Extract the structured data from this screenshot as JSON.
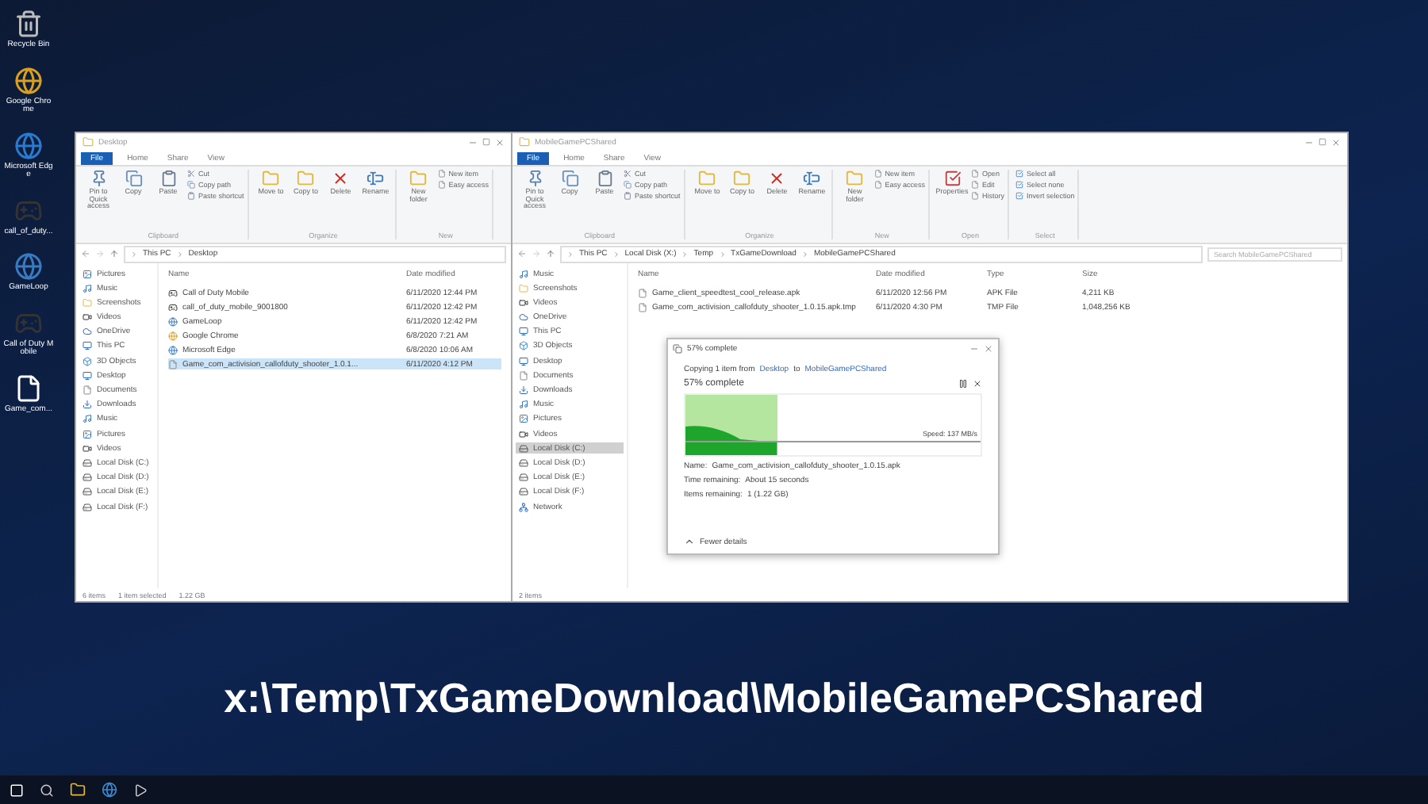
{
  "desktop_icons": [
    {
      "label": "Recycle Bin",
      "kind": "bin"
    },
    {
      "label": "Google Chrome",
      "kind": "browser"
    },
    {
      "label": "Microsoft Edge",
      "kind": "edge"
    },
    {
      "label": "call_of_duty...",
      "kind": "game"
    },
    {
      "label": "GameLoop",
      "kind": "loop"
    },
    {
      "label": "Call of Duty Mobile",
      "kind": "game"
    },
    {
      "label": "Game_com...",
      "kind": "file"
    }
  ],
  "windows": [
    {
      "title": "Desktop",
      "file_tab": "File",
      "tabs": [
        {
          "label": "Home",
          "selected": false
        },
        {
          "label": "Share",
          "selected": false
        },
        {
          "label": "View",
          "selected": false
        }
      ],
      "ribbon": [
        {
          "label": "Clipboard",
          "buttons": [
            {
              "label": "Pin to Quick access",
              "kind": "pin"
            },
            {
              "label": "Copy",
              "kind": "copy"
            },
            {
              "label": "Paste",
              "kind": "paste"
            }
          ],
          "small": [
            {
              "label": "Cut",
              "kind": "cut"
            },
            {
              "label": "Copy path",
              "kind": "copy"
            },
            {
              "label": "Paste shortcut",
              "kind": "paste"
            }
          ]
        },
        {
          "label": "Organize",
          "buttons": [
            {
              "label": "Move to",
              "kind": "folder"
            },
            {
              "label": "Copy to",
              "kind": "folder"
            },
            {
              "label": "Delete",
              "kind": "delete"
            },
            {
              "label": "Rename",
              "kind": "rename"
            }
          ]
        },
        {
          "label": "New",
          "buttons": [
            {
              "label": "New folder",
              "kind": "folder"
            }
          ],
          "small": [
            {
              "label": "New item",
              "kind": "file"
            },
            {
              "label": "Easy access",
              "kind": "file"
            }
          ]
        }
      ],
      "path": [
        "This PC",
        "Desktop"
      ],
      "nav": [
        {
          "label": "Pictures",
          "kind": "image",
          "selected": false
        },
        {
          "label": "Music",
          "kind": "music",
          "selected": false
        },
        {
          "label": "Screenshots",
          "kind": "folder",
          "selected": false
        },
        {
          "label": "Videos",
          "kind": "video",
          "selected": false
        },
        {
          "label": "OneDrive",
          "kind": "cloud",
          "selected": false
        },
        {
          "label": "This PC",
          "kind": "pc",
          "selected": false
        },
        {
          "label": "3D Objects",
          "kind": "box",
          "selected": false
        },
        {
          "label": "Desktop",
          "kind": "pc",
          "selected": false
        },
        {
          "label": "Documents",
          "kind": "file",
          "selected": false
        },
        {
          "label": "Downloads",
          "kind": "download",
          "selected": false
        },
        {
          "label": "Music",
          "kind": "music",
          "selected": false
        },
        {
          "label": "Pictures",
          "kind": "image",
          "selected": false
        },
        {
          "label": "Videos",
          "kind": "video",
          "selected": false
        },
        {
          "label": "Local Disk (C:)",
          "kind": "disk",
          "selected": false
        },
        {
          "label": "Local Disk (D:)",
          "kind": "disk",
          "selected": false
        },
        {
          "label": "Local Disk (E:)",
          "kind": "disk",
          "selected": false
        },
        {
          "label": "Local Disk (F:)",
          "kind": "disk",
          "selected": false
        }
      ],
      "columns": [
        "Name",
        "Date modified"
      ],
      "rows": [
        {
          "cells": [
            "Call of Duty Mobile",
            "6/11/2020 12:44 PM"
          ],
          "kind": "game",
          "selected": false
        },
        {
          "cells": [
            "call_of_duty_mobile_9001800",
            "6/11/2020 12:42 PM"
          ],
          "kind": "game",
          "selected": false
        },
        {
          "cells": [
            "GameLoop",
            "6/11/2020 12:42 PM"
          ],
          "kind": "loop",
          "selected": false
        },
        {
          "cells": [
            "Google Chrome",
            "6/8/2020 7:21 AM"
          ],
          "kind": "browser",
          "selected": false
        },
        {
          "cells": [
            "Microsoft Edge",
            "6/8/2020 10:06 AM"
          ],
          "kind": "edge",
          "selected": false
        },
        {
          "cells": [
            "Game_com_activision_callofduty_shooter_1.0.1...",
            "6/11/2020 4:12 PM"
          ],
          "kind": "file",
          "selected": true
        }
      ],
      "status": [
        "6 items",
        "1 item selected",
        "1.22 GB"
      ]
    },
    {
      "title": "MobileGamePCShared",
      "file_tab": "File",
      "tabs": [
        {
          "label": "Home",
          "selected": false
        },
        {
          "label": "Share",
          "selected": false
        },
        {
          "label": "View",
          "selected": false
        }
      ],
      "ribbon": [
        {
          "label": "Clipboard",
          "buttons": [
            {
              "label": "Pin to Quick access",
              "kind": "pin"
            },
            {
              "label": "Copy",
              "kind": "copy"
            },
            {
              "label": "Paste",
              "kind": "paste"
            }
          ],
          "small": [
            {
              "label": "Cut",
              "kind": "cut"
            },
            {
              "label": "Copy path",
              "kind": "copy"
            },
            {
              "label": "Paste shortcut",
              "kind": "paste"
            }
          ]
        },
        {
          "label": "Organize",
          "buttons": [
            {
              "label": "Move to",
              "kind": "folder"
            },
            {
              "label": "Copy to",
              "kind": "folder"
            },
            {
              "label": "Delete",
              "kind": "delete"
            },
            {
              "label": "Rename",
              "kind": "rename"
            }
          ]
        },
        {
          "label": "New",
          "buttons": [
            {
              "label": "New folder",
              "kind": "folder"
            }
          ],
          "small": [
            {
              "label": "New item",
              "kind": "file"
            },
            {
              "label": "Easy access",
              "kind": "file"
            }
          ]
        },
        {
          "label": "Open",
          "buttons": [
            {
              "label": "Properties",
              "kind": "props"
            }
          ],
          "small": [
            {
              "label": "Open",
              "kind": "file"
            },
            {
              "label": "Edit",
              "kind": "file"
            },
            {
              "label": "History",
              "kind": "file"
            }
          ]
        },
        {
          "label": "Select",
          "small": [
            {
              "label": "Select all",
              "kind": "select"
            },
            {
              "label": "Select none",
              "kind": "select"
            },
            {
              "label": "Invert selection",
              "kind": "select"
            }
          ]
        }
      ],
      "path": [
        "This PC",
        "Local Disk (X:)",
        "Temp",
        "TxGameDownload",
        "MobileGamePCShared"
      ],
      "search_placeholder": "Search MobileGamePCShared",
      "nav": [
        {
          "label": "Music",
          "kind": "music",
          "selected": false
        },
        {
          "label": "Screenshots",
          "kind": "folder",
          "selected": false
        },
        {
          "label": "Videos",
          "kind": "video",
          "selected": false
        },
        {
          "label": "OneDrive",
          "kind": "cloud",
          "selected": false
        },
        {
          "label": "This PC",
          "kind": "pc",
          "selected": false
        },
        {
          "label": "3D Objects",
          "kind": "box",
          "selected": false
        },
        {
          "label": "Desktop",
          "kind": "pc",
          "selected": false
        },
        {
          "label": "Documents",
          "kind": "file",
          "selected": false
        },
        {
          "label": "Downloads",
          "kind": "download",
          "selected": false
        },
        {
          "label": "Music",
          "kind": "music",
          "selected": false
        },
        {
          "label": "Pictures",
          "kind": "image",
          "selected": false
        },
        {
          "label": "Videos",
          "kind": "video",
          "selected": false
        },
        {
          "label": "Local Disk (C:)",
          "kind": "disk",
          "selected": true
        },
        {
          "label": "Local Disk (D:)",
          "kind": "disk",
          "selected": false
        },
        {
          "label": "Local Disk (E:)",
          "kind": "disk",
          "selected": false
        },
        {
          "label": "Local Disk (F:)",
          "kind": "disk",
          "selected": false
        },
        {
          "label": "Network",
          "kind": "network",
          "selected": false
        }
      ],
      "columns": [
        "Name",
        "Date modified",
        "Type",
        "Size"
      ],
      "rows": [
        {
          "cells": [
            "Game_client_speedtest_cool_release.apk",
            "6/11/2020 12:56 PM",
            "APK File",
            "4,211 KB"
          ],
          "kind": "file",
          "selected": false
        },
        {
          "cells": [
            "Game_com_activision_callofduty_shooter_1.0.15.apk.tmp",
            "6/11/2020 4:30 PM",
            "TMP File",
            "1,048,256 KB"
          ],
          "kind": "file",
          "selected": false
        }
      ],
      "status": [
        "2 items"
      ]
    }
  ],
  "copy_dialog": {
    "title": "57% complete",
    "copying": {
      "text": "Copying 1 item from",
      "source": "Desktop",
      "joiner": "to",
      "destination": "MobileGamePCShared"
    },
    "progress_text": "57% complete",
    "level": 0.31,
    "speed": "Speed: 137 MB/s",
    "details": [
      {
        "label": "Name:",
        "value": "Game_com_activision_callofduty_shooter_1.0.15.apk"
      },
      {
        "label": "Time remaining:",
        "value": "About 15 seconds"
      },
      {
        "label": "Items remaining:",
        "value": "1 (1.22 GB)"
      }
    ],
    "more": "Fewer details"
  },
  "caption": "x:\\Temp\\TxGameDownload\\MobileGamePCShared"
}
